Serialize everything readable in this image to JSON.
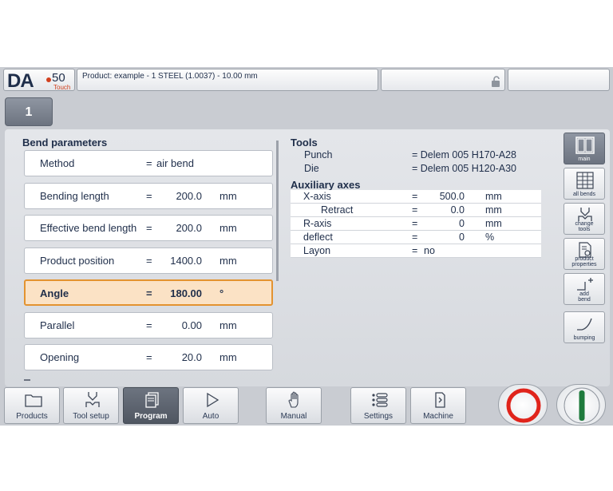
{
  "header": {
    "logo_text": "DA",
    "logo_number": "50",
    "logo_touch": "Touch",
    "product_info": "Product: example - 1 STEEL (1.0037) - 10.00 mm"
  },
  "bend_tab": "1",
  "bend_parameters": {
    "title": "Bend parameters",
    "rows": [
      {
        "label": "Method",
        "eq": "=",
        "value": "air bend",
        "unit": ""
      },
      {
        "label": "Bending length",
        "eq": "=",
        "value": "200.0",
        "unit": "mm"
      },
      {
        "label": "Effective bend length",
        "eq": "=",
        "value": "200.0",
        "unit": "mm"
      },
      {
        "label": "Product position",
        "eq": "=",
        "value": "1400.0",
        "unit": "mm"
      },
      {
        "label": "Angle",
        "eq": "=",
        "value": "180.00",
        "unit": "°"
      },
      {
        "label": "Parallel",
        "eq": "=",
        "value": "0.00",
        "unit": "mm"
      },
      {
        "label": "Opening",
        "eq": "=",
        "value": "20.0",
        "unit": "mm"
      }
    ]
  },
  "tools": {
    "title": "Tools",
    "punch_label": "Punch",
    "punch_value": "= Delem 005 H170-A28",
    "die_label": "Die",
    "die_value": "= Delem 005 H120-A30"
  },
  "auxiliary_axes": {
    "title": "Auxiliary axes",
    "rows": [
      {
        "label": "X-axis",
        "eq": "=",
        "value": "500.0",
        "unit": "mm"
      },
      {
        "label": "Retract",
        "eq": "=",
        "value": "0.0",
        "unit": "mm"
      },
      {
        "label": "R-axis",
        "eq": "=",
        "value": "0",
        "unit": "mm"
      },
      {
        "label": "deflect",
        "eq": "=",
        "value": "0",
        "unit": "%"
      },
      {
        "label": "Layon",
        "eq": "=",
        "value": "no",
        "unit": ""
      }
    ]
  },
  "side_buttons": {
    "main": "main",
    "all_bends": "all bends",
    "change_tools_1": "change",
    "change_tools_2": "tools",
    "product_properties_1": "product",
    "product_properties_2": "properties",
    "add_bend_1": "add",
    "add_bend_2": "bend",
    "bumping": "bumping"
  },
  "nav": {
    "products": "Products",
    "tool_setup": "Tool setup",
    "program": "Program",
    "auto": "Auto",
    "manual": "Manual",
    "settings": "Settings",
    "machine": "Machine"
  },
  "colors": {
    "selected_row_bg": "#fbe2c5",
    "selected_row_border": "#e39330",
    "stop_red": "#e0241b",
    "start_green": "#1e7a3c"
  }
}
